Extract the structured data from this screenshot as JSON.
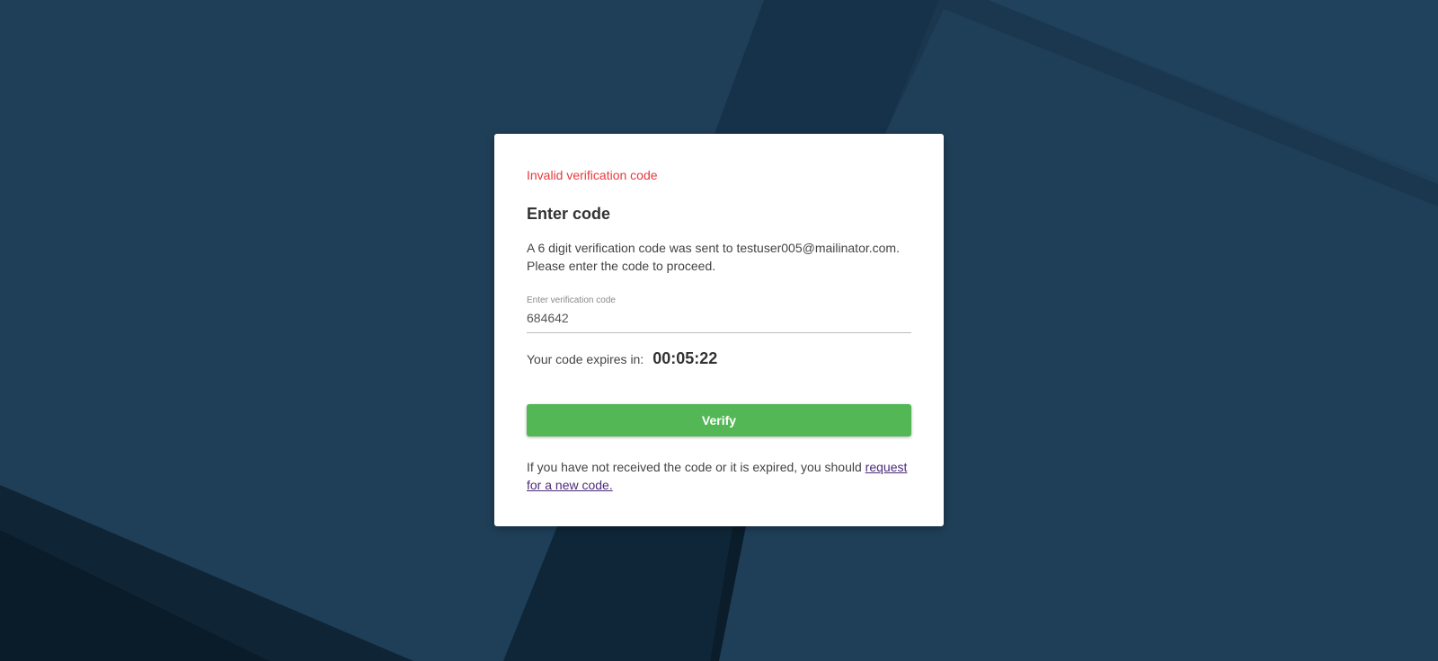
{
  "card": {
    "error_message": "Invalid verification code",
    "title": "Enter code",
    "description_line1": "A 6 digit verification code was sent to testuser005@mailinator.com.",
    "description_line2": "Please enter the code to proceed.",
    "code_field": {
      "label": "Enter verification code",
      "value": "684642"
    },
    "expiry_label": "Your code expires in:",
    "expiry_time": "00:05:22",
    "verify_label": "Verify",
    "footer_text": "If you have not received the code or it is expired, you should ",
    "footer_link": "request for a new code."
  },
  "colors": {
    "background": "#1e3d55",
    "error": "#e8393d",
    "button": "#54b756",
    "link": "#4b2c7a"
  }
}
